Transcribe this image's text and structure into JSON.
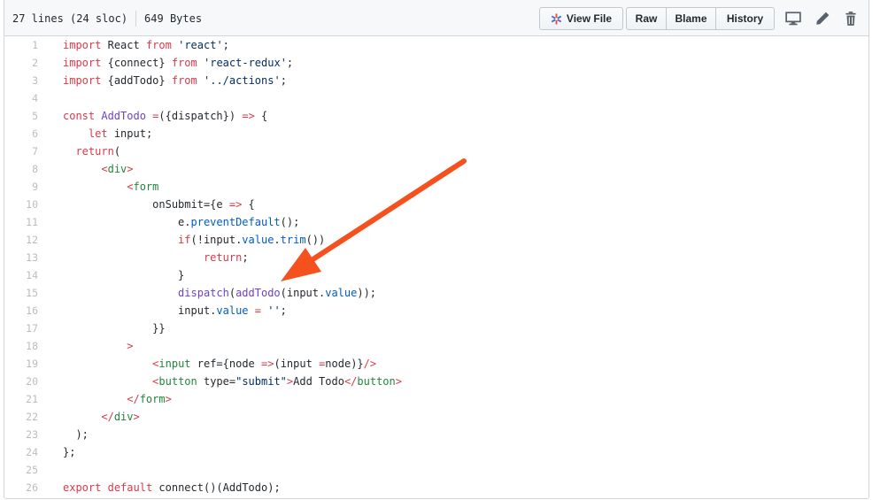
{
  "file_header": {
    "lines_info": "27 lines (24 sloc)",
    "size": "649 Bytes",
    "buttons": {
      "view_file": "View File",
      "raw": "Raw",
      "blame": "Blame",
      "history": "History"
    },
    "icons": [
      "desktop-icon",
      "pencil-icon",
      "trash-icon"
    ]
  },
  "code": {
    "line_numbers": [
      "1",
      "2",
      "3",
      "4",
      "5",
      "6",
      "7",
      "8",
      "9",
      "10",
      "11",
      "12",
      "13",
      "14",
      "15",
      "16",
      "17",
      "18",
      "19",
      "20",
      "21",
      "22",
      "23",
      "24",
      "25",
      "26"
    ],
    "lines": [
      [
        [
          "k",
          "import"
        ],
        [
          "",
          "React"
        ],
        [
          "k",
          "from"
        ],
        [
          "s",
          "'react'"
        ],
        [
          "",
          ";"
        ]
      ],
      [
        [
          "k",
          "import"
        ],
        [
          "",
          "{connect}"
        ],
        [
          "k",
          "from"
        ],
        [
          "s",
          "'react-redux'"
        ],
        [
          "",
          ";"
        ]
      ],
      [
        [
          "k",
          "import"
        ],
        [
          "",
          "{addTodo}"
        ],
        [
          "k",
          "from"
        ],
        [
          "s",
          "'../actions'"
        ],
        [
          "",
          ";"
        ]
      ],
      [],
      [
        [
          "k",
          "const"
        ],
        [
          "e",
          "AddTodo"
        ],
        [
          "k",
          "="
        ],
        [
          "",
          "({dispatch})"
        ],
        [
          "k",
          "=>"
        ],
        [
          "",
          "{"
        ]
      ],
      [
        [
          "",
          "    "
        ],
        [
          "k",
          "let"
        ],
        [
          "",
          "input;"
        ]
      ],
      [
        [
          "",
          "  "
        ],
        [
          "k",
          "return"
        ],
        [
          "",
          "("
        ]
      ],
      [
        [
          "",
          "      "
        ],
        [
          "k",
          "<"
        ],
        [
          "ent",
          "div"
        ],
        [
          "k",
          ">"
        ]
      ],
      [
        [
          "",
          "          "
        ],
        [
          "k",
          "<"
        ],
        [
          "ent",
          "form"
        ]
      ],
      [
        [
          "",
          "              onSubmit="
        ],
        [
          "",
          "{e"
        ],
        [
          "k",
          "=>"
        ],
        [
          "",
          "{"
        ]
      ],
      [
        [
          "",
          "                  e."
        ],
        [
          "c1",
          "preventDefault"
        ],
        [
          "",
          "();"
        ]
      ],
      [
        [
          "",
          "                  "
        ],
        [
          "k",
          "if"
        ],
        [
          "",
          "(!input."
        ],
        [
          "c1",
          "value"
        ],
        [
          "",
          "."
        ],
        [
          "c1",
          "trim"
        ],
        [
          "",
          "())"
        ]
      ],
      [
        [
          "",
          "                      "
        ],
        [
          "k",
          "return"
        ],
        [
          "",
          ";"
        ]
      ],
      [
        [
          "",
          "                  }"
        ]
      ],
      [
        [
          "",
          "                  "
        ],
        [
          "e",
          "dispatch"
        ],
        [
          "",
          "("
        ],
        [
          "e",
          "addTodo"
        ],
        [
          "",
          "(input."
        ],
        [
          "c1",
          "value"
        ],
        [
          "",
          "));"
        ]
      ],
      [
        [
          "",
          "                  input."
        ],
        [
          "c1",
          "value"
        ],
        [
          "k",
          "="
        ],
        [
          "s",
          "''"
        ],
        [
          "",
          ";"
        ]
      ],
      [
        [
          "",
          "              }}"
        ]
      ],
      [
        [
          "",
          "          "
        ],
        [
          "k",
          ">"
        ]
      ],
      [
        [
          "",
          "              "
        ],
        [
          "k",
          "<"
        ],
        [
          "ent",
          "input"
        ],
        [
          "",
          "ref="
        ],
        [
          "",
          "{node"
        ],
        [
          "k",
          "=>"
        ],
        [
          "",
          "(input"
        ],
        [
          "k",
          "="
        ],
        [
          "",
          "node)}"
        ],
        [
          "k",
          "/>"
        ]
      ],
      [
        [
          "",
          "              "
        ],
        [
          "k",
          "<"
        ],
        [
          "ent",
          "button"
        ],
        [
          "",
          "type="
        ],
        [
          "s",
          "\"submit\""
        ],
        [
          "k",
          ">"
        ],
        [
          "",
          "Add Todo"
        ],
        [
          "k",
          "</"
        ],
        [
          "ent",
          "button"
        ],
        [
          "k",
          ">"
        ]
      ],
      [
        [
          "",
          "          "
        ],
        [
          "k",
          "</"
        ],
        [
          "ent",
          "form"
        ],
        [
          "k",
          ">"
        ]
      ],
      [
        [
          "",
          "      "
        ],
        [
          "k",
          "</"
        ],
        [
          "ent",
          "div"
        ],
        [
          "k",
          ">"
        ]
      ],
      [
        [
          "",
          "  );"
        ]
      ],
      [
        [
          "",
          "};"
        ]
      ],
      [],
      [
        [
          "k",
          "export"
        ],
        [
          "k",
          "default"
        ],
        [
          "",
          "connect()(AddTodo);"
        ]
      ]
    ]
  },
  "colors": {
    "keyword": "#d73a49",
    "string": "#032f62",
    "entity": "#6f42c1",
    "constant": "#005cc5",
    "tag": "#22863a",
    "annotation_arrow": "#f4511e"
  }
}
